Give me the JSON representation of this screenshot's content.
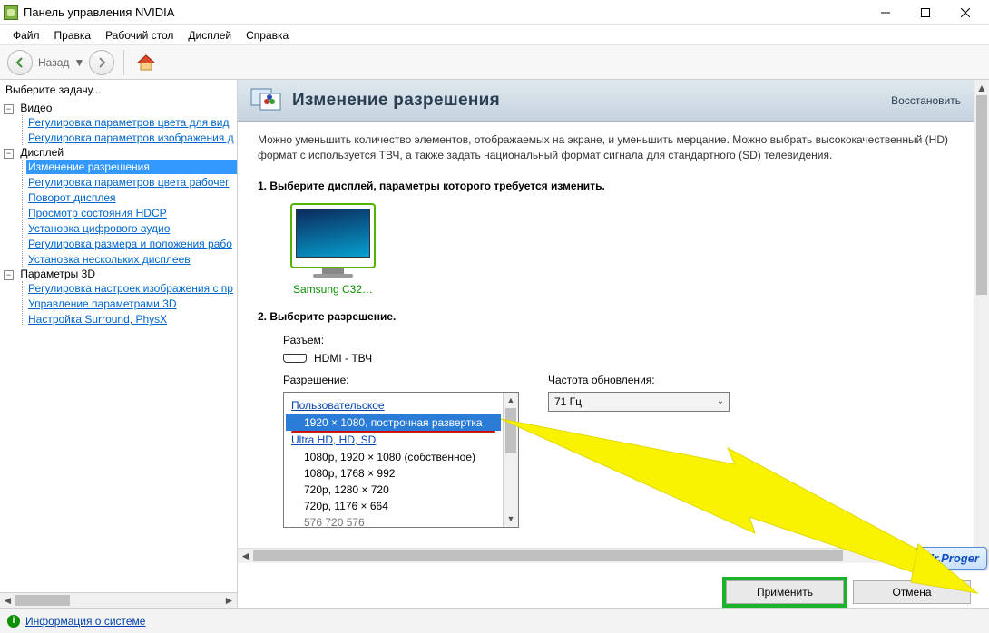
{
  "window": {
    "title": "Панель управления NVIDIA"
  },
  "menus": {
    "file": "Файл",
    "edit": "Правка",
    "desktop": "Рабочий стол",
    "display": "Дисплей",
    "help": "Справка"
  },
  "toolbar": {
    "back_label": "Назад"
  },
  "sidebar": {
    "prompt": "Выберите задачу...",
    "categories": [
      {
        "label": "Видео",
        "items": [
          "Регулировка параметров цвета для вид",
          "Регулировка параметров изображения д"
        ]
      },
      {
        "label": "Дисплей",
        "items": [
          "Изменение разрешения",
          "Регулировка параметров цвета рабочег",
          "Поворот дисплея",
          "Просмотр состояния HDCP",
          "Установка цифрового аудио",
          "Регулировка размера и положения рабо",
          "Установка нескольких дисплеев"
        ]
      },
      {
        "label": "Параметры 3D",
        "items": [
          "Регулировка настроек изображения с пр",
          "Управление параметрами 3D",
          "Настройка Surround, PhysX"
        ]
      }
    ],
    "selected": "Изменение разрешения"
  },
  "page": {
    "title": "Изменение разрешения",
    "restore": "Восстановить",
    "description": "Можно уменьшить количество элементов, отображаемых на экране, и уменьшить мерцание. Можно выбрать высококачественный (HD) формат с используется ТВЧ, а также задать национальный формат сигнала для стандартного (SD) телевидения.",
    "step1": "1. Выберите дисплей, параметры которого требуется изменить.",
    "monitor_label": "Samsung C32…",
    "step2": "2. Выберите разрешение.",
    "connector_label": "Разъем:",
    "connector_value": "HDMI - ТВЧ",
    "resolution_label": "Разрешение:",
    "refresh_label": "Частота обновления:",
    "refresh_value": "71 Гц",
    "listbox": {
      "group1": "Пользовательское",
      "selected": "1920 × 1080, построчная развертка",
      "group2": "Ultra HD, HD, SD",
      "items": [
        "1080p, 1920 × 1080 (собственное)",
        "1080p, 1768 × 992",
        "720p, 1280 × 720",
        "720p, 1176 × 664"
      ],
      "partial": "576   720   576"
    }
  },
  "buttons": {
    "apply": "Применить",
    "cancel": "Отмена"
  },
  "statusbar": {
    "info_link": "Информация о системе"
  },
  "badge": "Mr.Proger"
}
